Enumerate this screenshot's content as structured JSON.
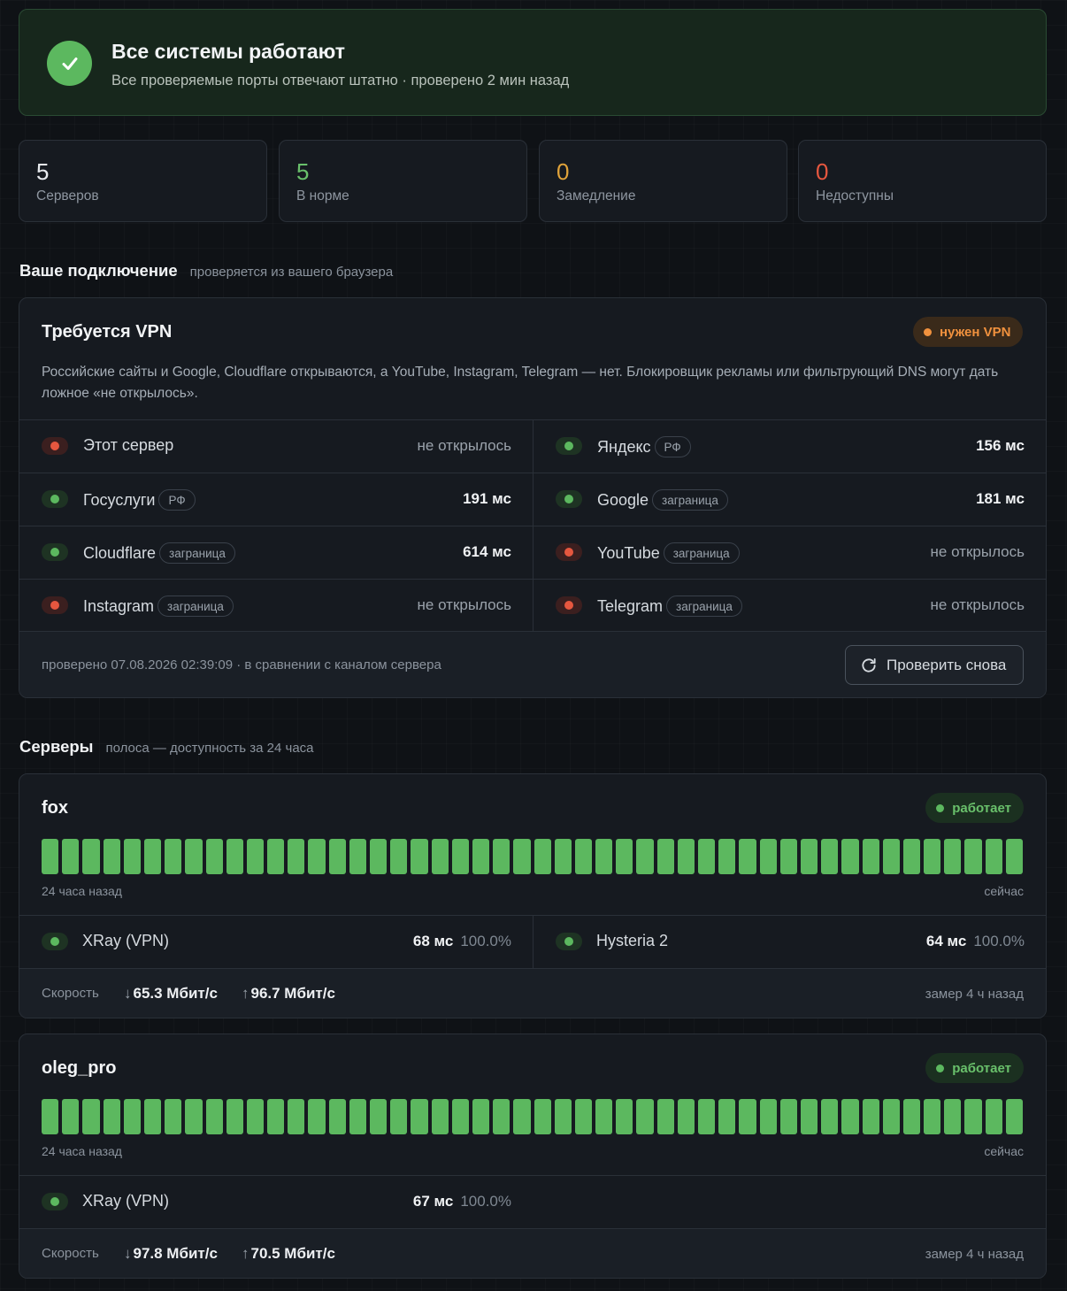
{
  "banner": {
    "title": "Все системы работают",
    "subtitle": "Все проверяемые порты отвечают штатно · проверено 2 мин назад"
  },
  "stats": [
    {
      "value": "5",
      "label": "Серверов",
      "color": "#e8ebef"
    },
    {
      "value": "5",
      "label": "В норме",
      "color": "#69c06b"
    },
    {
      "value": "0",
      "label": "Замедление",
      "color": "#e0a33a"
    },
    {
      "value": "0",
      "label": "Недоступны",
      "color": "#e5573f"
    }
  ],
  "connection": {
    "title": "Ваше подключение",
    "subtitle": "проверяется из вашего браузера",
    "card_title": "Требуется VPN",
    "badge": "нужен VPN",
    "description": "Российские сайты и Google, Cloudflare открываются, а YouTube, Instagram, Telegram — нет. Блокировщик рекламы или фильтрующий DNS могут дать ложное «не открылось».",
    "checks": [
      {
        "name": "Этот сервер",
        "tag": "",
        "status": "fail",
        "value": "не открылось"
      },
      {
        "name": "Яндекс",
        "tag": "РФ",
        "status": "ok",
        "value": "156 мс"
      },
      {
        "name": "Госуслуги",
        "tag": "РФ",
        "status": "ok",
        "value": "191 мс"
      },
      {
        "name": "Google",
        "tag": "заграница",
        "status": "ok",
        "value": "181 мс"
      },
      {
        "name": "Cloudflare",
        "tag": "заграница",
        "status": "ok",
        "value": "614 мс"
      },
      {
        "name": "YouTube",
        "tag": "заграница",
        "status": "fail",
        "value": "не открылось"
      },
      {
        "name": "Instagram",
        "tag": "заграница",
        "status": "fail",
        "value": "не открылось"
      },
      {
        "name": "Telegram",
        "tag": "заграница",
        "status": "fail",
        "value": "не открылось"
      }
    ],
    "footer_text": "проверено 07.08.2026 02:39:09 · в сравнении с каналом сервера",
    "recheck_label": "Проверить снова"
  },
  "servers_section": {
    "title": "Серверы",
    "subtitle": "полоса — доступность за 24 часа"
  },
  "servers": [
    {
      "name": "fox",
      "status": "работает",
      "uptime_bars": 48,
      "uptime_bar_status": "ok",
      "timeline_start": "24 часа назад",
      "timeline_end": "сейчас",
      "protocols": [
        {
          "name": "XRay (VPN)",
          "latency": "68 мс",
          "uptime": "100.0%"
        },
        {
          "name": "Hysteria 2",
          "latency": "64 мс",
          "uptime": "100.0%"
        }
      ],
      "speed_label": "Скорость",
      "down": "65.3 Мбит/с",
      "up": "96.7 Мбит/с",
      "measured": "замер 4 ч назад"
    },
    {
      "name": "oleg_pro",
      "status": "работает",
      "uptime_bars": 48,
      "uptime_bar_status": "ok",
      "timeline_start": "24 часа назад",
      "timeline_end": "сейчас",
      "protocols": [
        {
          "name": "XRay (VPN)",
          "latency": "67 мс",
          "uptime": "100.0%"
        }
      ],
      "speed_label": "Скорость",
      "down": "97.8 Мбит/с",
      "up": "70.5 Мбит/с",
      "measured": "замер 4 ч назад"
    }
  ],
  "icons": {
    "banner": "check-icon",
    "recheck": "refresh-icon",
    "down": "arrow-down-icon",
    "up": "arrow-up-icon"
  },
  "colors": {
    "ok": "#5cb85f",
    "fail": "#e5573f",
    "warn": "#f0913e"
  }
}
